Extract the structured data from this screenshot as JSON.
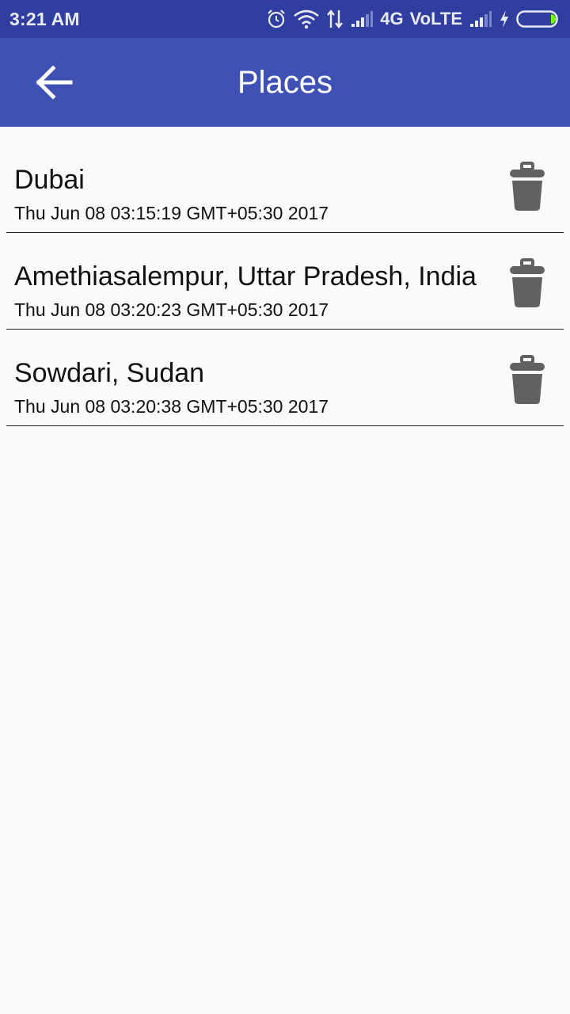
{
  "status_bar": {
    "time": "3:21 AM",
    "network": "4G",
    "volte": "VoLTE",
    "icons": [
      "alarm-icon",
      "wifi-icon",
      "data-transfer-icon",
      "signal-icon",
      "signal-icon",
      "charging-icon",
      "battery-icon"
    ],
    "battery_fill_fraction": 0.12
  },
  "app_bar": {
    "title": "Places",
    "back_icon": "arrow-back-icon"
  },
  "places": [
    {
      "name": "Dubai",
      "date": "Thu Jun 08 03:15:19 GMT+05:30 2017"
    },
    {
      "name": "Amethiasalempur, Uttar Pradesh, India",
      "date": "Thu Jun 08 03:20:23 GMT+05:30 2017"
    },
    {
      "name": "Sowdari, Sudan",
      "date": "Thu Jun 08 03:20:38 GMT+05:30 2017"
    }
  ],
  "colors": {
    "status_bar": "#303f9f",
    "app_bar": "#3f51b5",
    "background": "#fafafa",
    "trash_icon": "#616161",
    "battery_accent": "#76ff03"
  }
}
